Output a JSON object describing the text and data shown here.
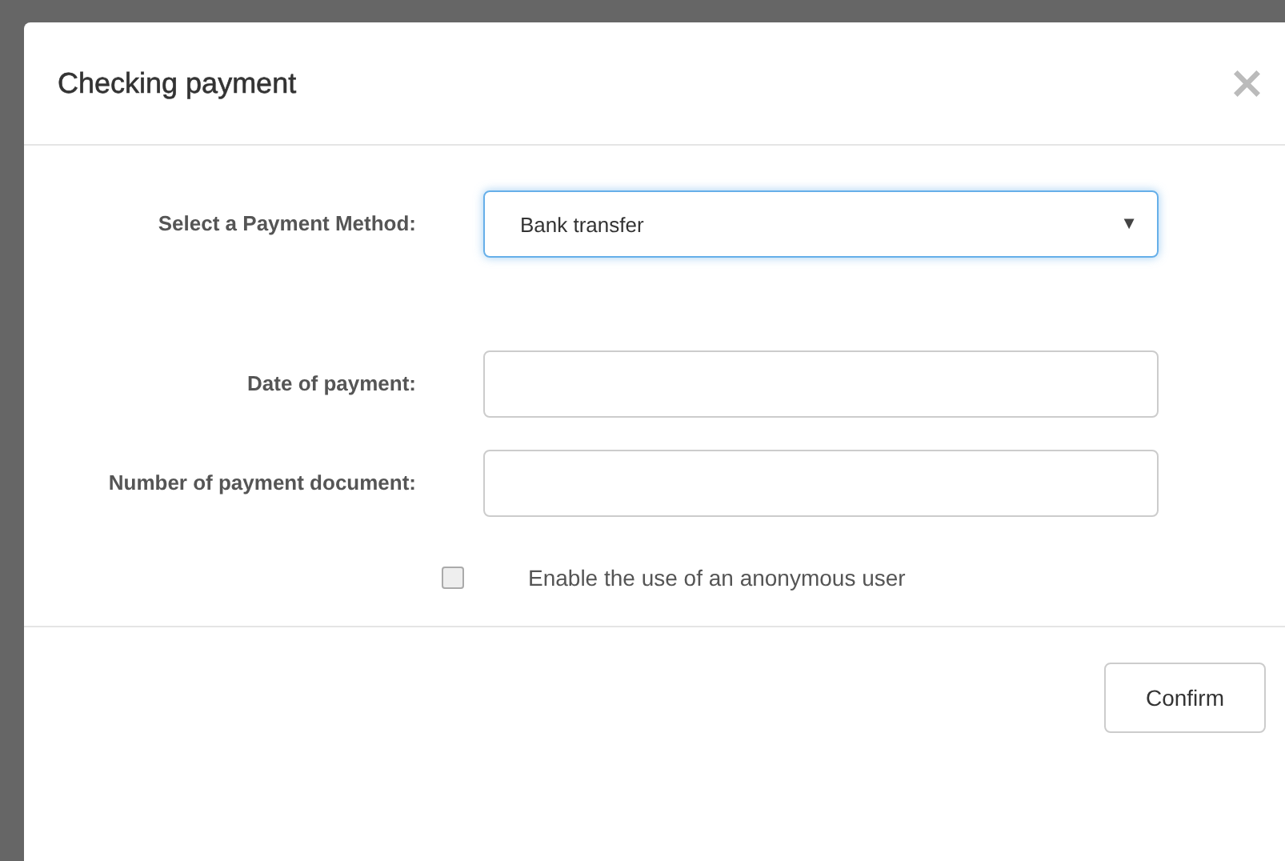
{
  "dialog": {
    "title": "Checking payment",
    "close": "×"
  },
  "fields": [
    {
      "kind": "select",
      "label": "Select a Payment Method:",
      "value": "Bank transfer",
      "arrow": "▼",
      "focused": true
    },
    {
      "kind": "text",
      "label": "Date of payment:",
      "focused": false
    },
    {
      "kind": "text",
      "label": "Number of payment document:",
      "focused": false
    }
  ],
  "checkbox": {
    "label": "Enable the use of an anonymous user",
    "checked": false
  },
  "buttons": [
    "Confirm"
  ]
}
